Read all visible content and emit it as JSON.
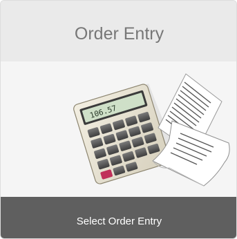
{
  "card": {
    "title": "Order Entry",
    "illustration_icon": "calculator-and-papers-icon",
    "calculator_display": "106.57",
    "footer_label": "Select Order Entry"
  },
  "colors": {
    "header_background": "#eaeaea",
    "title_text": "#777777",
    "body_background": "#f5f5f5",
    "footer_background": "#5f5f5f",
    "footer_text": "#ffffff",
    "calculator_display": "#cfe0c8",
    "accent_key": "#c0305a"
  }
}
